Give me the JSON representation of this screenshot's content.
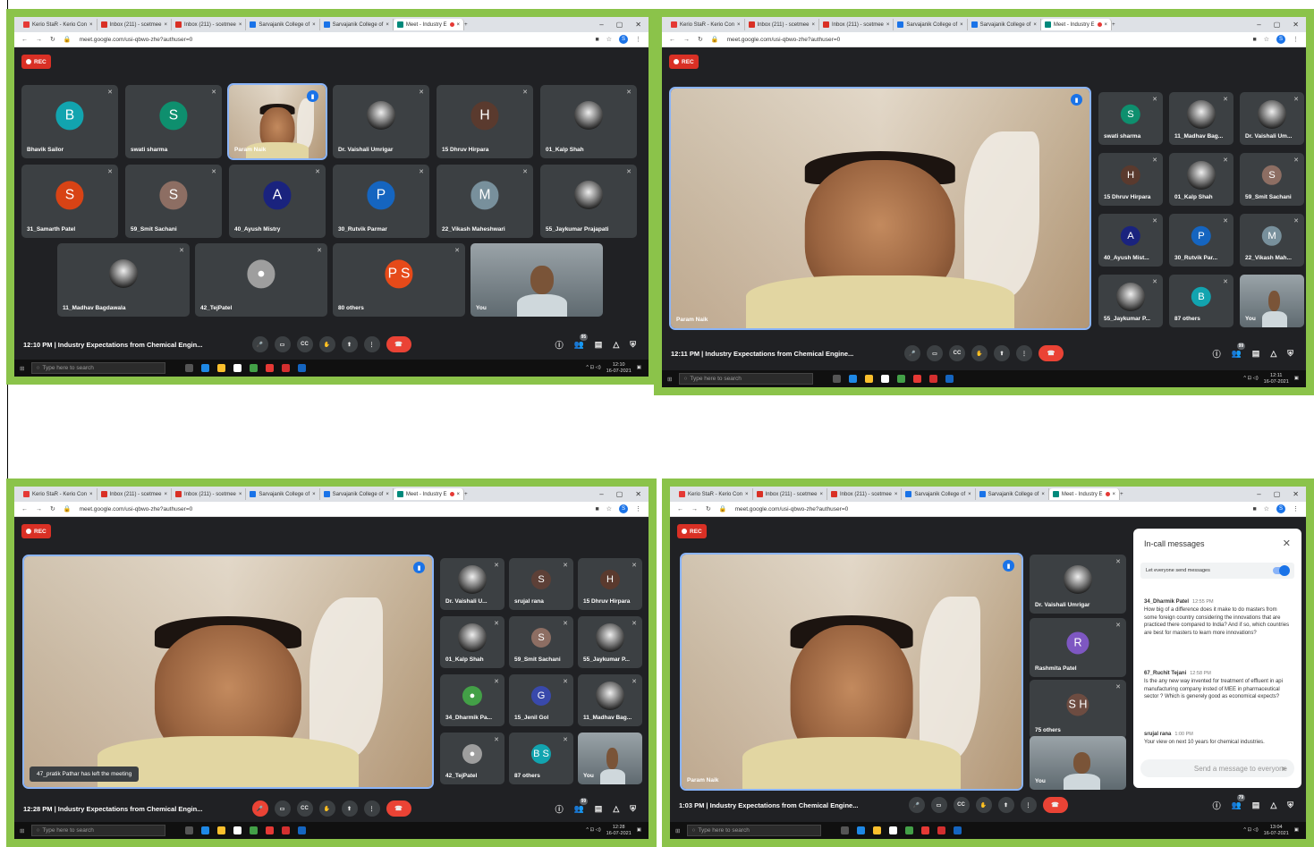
{
  "browser": {
    "tabs": [
      "Kerio StaR - Kerio Con",
      "Inbox (211) - scetmee",
      "Inbox (211) - scetmee",
      "Sarvajanik College of",
      "Sarvajanik College of",
      "Meet - Industry E"
    ],
    "url": "meet.google.com/usi-qbwo-zhe?authuser=0",
    "profile": "S"
  },
  "meeting": {
    "title": "Industry Expectations from Chemical Engin...",
    "title_full": "Industry Expectations from Chemical Engine...",
    "rec": "REC",
    "speaker": "Param Naik",
    "you": "You"
  },
  "taskbar": {
    "search": "Type here to search",
    "date": "16-07-2021"
  },
  "screens": [
    {
      "time": "12:10 PM",
      "clock": "12:10",
      "participants_count": "95",
      "tiles": [
        {
          "name": "Bhavik Sailor",
          "initial": "B",
          "color": "#12a4af"
        },
        {
          "name": "swati sharma",
          "initial": "S",
          "color": "#0e8f6e"
        },
        {
          "name": "Param Naik",
          "video": true
        },
        {
          "name": "Dr. Vaishali Umrigar",
          "photo": true
        },
        {
          "name": "15 Dhruv Hirpara",
          "initial": "H",
          "color": "#5a3a2e"
        },
        {
          "name": "01_Kalp Shah",
          "photo": true
        },
        {
          "name": "31_Samarth Patel",
          "initial": "S",
          "color": "#d84315"
        },
        {
          "name": "59_Smit Sachani",
          "initial": "S",
          "color": "#8d6e63"
        },
        {
          "name": "40_Ayush Mistry",
          "initial": "A",
          "color": "#1a237e"
        },
        {
          "name": "30_Rutvik Parmar",
          "initial": "P",
          "color": "#1565c0"
        },
        {
          "name": "22_Vikash Maheshwari",
          "initial": "M",
          "color": "#78909c"
        },
        {
          "name": "55_Jaykumar Prajapati",
          "photo": true
        },
        {
          "name": "11_Madhav Bagdawala",
          "photo": true
        },
        {
          "name": "42_TejPatel",
          "initial": "",
          "color": "#9e9e9e"
        },
        {
          "name": "80 others",
          "initial": "P S",
          "color": "#e64a19"
        },
        {
          "name": "You",
          "video": true
        }
      ]
    },
    {
      "time": "12:11 PM",
      "clock": "12:11",
      "participants_count": "99",
      "tiles": [
        {
          "name": "swati sharma",
          "initial": "S",
          "color": "#0e8f6e"
        },
        {
          "name": "11_Madhav Bag...",
          "photo": true
        },
        {
          "name": "Dr. Vaishali Um...",
          "photo": true
        },
        {
          "name": "15 Dhruv Hirpara",
          "initial": "H",
          "color": "#5a3a2e"
        },
        {
          "name": "01_Kalp Shah",
          "photo": true
        },
        {
          "name": "59_Smit Sachani",
          "initial": "S",
          "color": "#8d6e63"
        },
        {
          "name": "40_Ayush Mist...",
          "initial": "A",
          "color": "#1a237e"
        },
        {
          "name": "30_Rutvik Par...",
          "initial": "P",
          "color": "#1565c0"
        },
        {
          "name": "22_Vikash Mah...",
          "initial": "M",
          "color": "#78909c"
        },
        {
          "name": "55_Jaykumar P...",
          "photo": true
        },
        {
          "name": "87 others",
          "initial": "B",
          "color": "#12a4af"
        },
        {
          "name": "You",
          "video": true
        }
      ]
    },
    {
      "time": "12:28 PM",
      "clock": "12:28",
      "participants_count": "99",
      "toast": "47_pratik Pathar has left the meeting",
      "tiles": [
        {
          "name": "Dr. Vaishali U...",
          "photo": true
        },
        {
          "name": "srujal rana",
          "initial": "S",
          "color": "#5d4037"
        },
        {
          "name": "15 Dhruv Hirpara",
          "initial": "H",
          "color": "#5a3a2e"
        },
        {
          "name": "01_Kalp Shah",
          "photo": true
        },
        {
          "name": "59_Smit Sachani",
          "initial": "S",
          "color": "#8d6e63"
        },
        {
          "name": "55_Jaykumar P...",
          "photo": true
        },
        {
          "name": "34_Dharmik Pa...",
          "initial": "",
          "color": "#43a047"
        },
        {
          "name": "15_Jenil Gol",
          "initial": "G",
          "color": "#3949ab"
        },
        {
          "name": "11_Madhav Bag...",
          "photo": true
        },
        {
          "name": "42_TejPatel",
          "initial": "",
          "color": "#9e9e9e"
        },
        {
          "name": "87 others",
          "initial": "B S",
          "color": "#12a4af"
        },
        {
          "name": "You",
          "video": true
        }
      ]
    },
    {
      "time": "1:03 PM",
      "clock": "13:04",
      "participants_count": "79",
      "tiles": [
        {
          "name": "Dr. Vaishali Umrigar",
          "photo": true
        },
        {
          "name": "Rashmita Patel",
          "initial": "R",
          "color": "#7e57c2"
        },
        {
          "name": "75 others",
          "initial": "S H",
          "color": "#6d4c41"
        },
        {
          "name": "You",
          "video": true
        }
      ],
      "chat": {
        "title": "In-call messages",
        "toggle": "Let everyone send messages",
        "placeholder": "Send a message to everyone",
        "messages": [
          {
            "author": "34_Dharmik Patel",
            "time": "12:55 PM",
            "text": "How big of a difference does it make to do masters from some foreign country considering the innovations that are practiced there compared to India? And if so, which countries are best for masters to learn more innovations?"
          },
          {
            "author": "67_Ruchit Tejani",
            "time": "12:58 PM",
            "text": "Is the any new way invented for treatment of effluent in api manufacturing company insted of MEE in pharmaceutical sector ? Which is generely good as economical expects?"
          },
          {
            "author": "srujal rana",
            "time": "1:00 PM",
            "text": "Your view on next 10 years for chemical industries."
          }
        ]
      }
    }
  ]
}
